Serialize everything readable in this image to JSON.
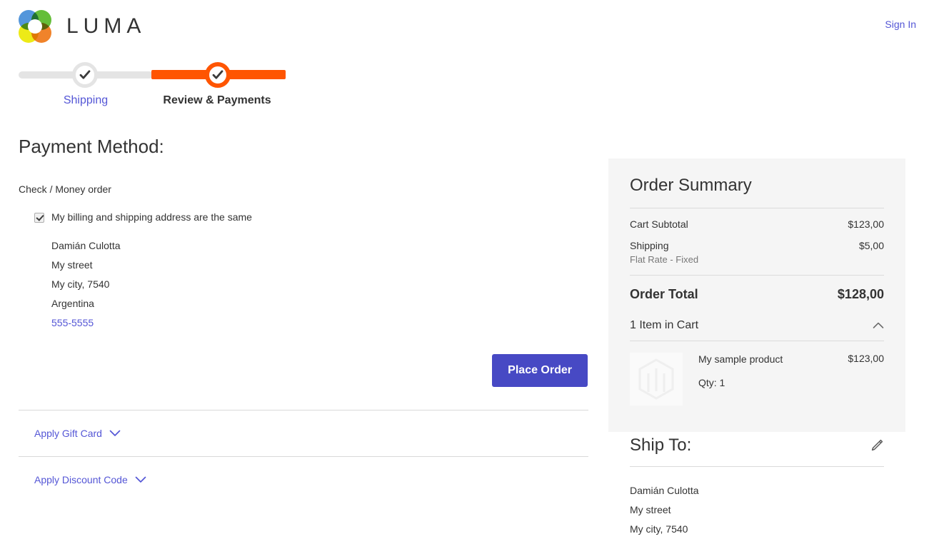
{
  "header": {
    "brand": "LUMA",
    "brand_logo_icon": "luma-flower-logo",
    "sign_in_label": "Sign In"
  },
  "progress": {
    "steps": [
      {
        "label": "Shipping",
        "state": "completed",
        "icon": "check-icon"
      },
      {
        "label": "Review & Payments",
        "state": "active",
        "icon": "check-icon"
      }
    ]
  },
  "payment": {
    "page_title": "Payment Method:",
    "method_name": "Check / Money order",
    "billing_same_label": "My billing and shipping address are the same",
    "billing_same_checked": true,
    "billing_address": {
      "name": "Damián Culotta",
      "street": "My street",
      "city_zip": "My city, 7540",
      "country": "Argentina",
      "phone": "555-5555"
    },
    "place_order_label": "Place Order",
    "accordion": [
      {
        "label": "Apply Gift Card",
        "icon": "chevron-down-icon"
      },
      {
        "label": "Apply Discount Code",
        "icon": "chevron-down-icon"
      }
    ]
  },
  "order_summary": {
    "title": "Order Summary",
    "rows": [
      {
        "label": "Cart Subtotal",
        "sub": "",
        "value": "$123,00"
      },
      {
        "label": "Shipping",
        "sub": "Flat Rate - Fixed",
        "value": "$5,00"
      }
    ],
    "grand_total": {
      "label": "Order Total",
      "value": "$128,00"
    },
    "items_toggle": {
      "label": "1 Item in Cart",
      "icon": "chevron-up-icon",
      "expanded": true
    },
    "items": [
      {
        "name": "My sample product",
        "qty_label": "Qty: 1",
        "price": "$123,00",
        "thumb_icon": "magento-placeholder-icon"
      }
    ]
  },
  "ship_to": {
    "title": "Ship To:",
    "edit_icon": "pencil-icon",
    "address": {
      "name": "Damián Culotta",
      "street": "My street",
      "city_zip": "My city, 7540"
    }
  },
  "colors": {
    "accent_orange": "#ff5501",
    "link_violet": "#5456d6",
    "button_blue": "#4749c4",
    "panel_gray": "#f5f5f5",
    "text_dark": "#333333"
  }
}
